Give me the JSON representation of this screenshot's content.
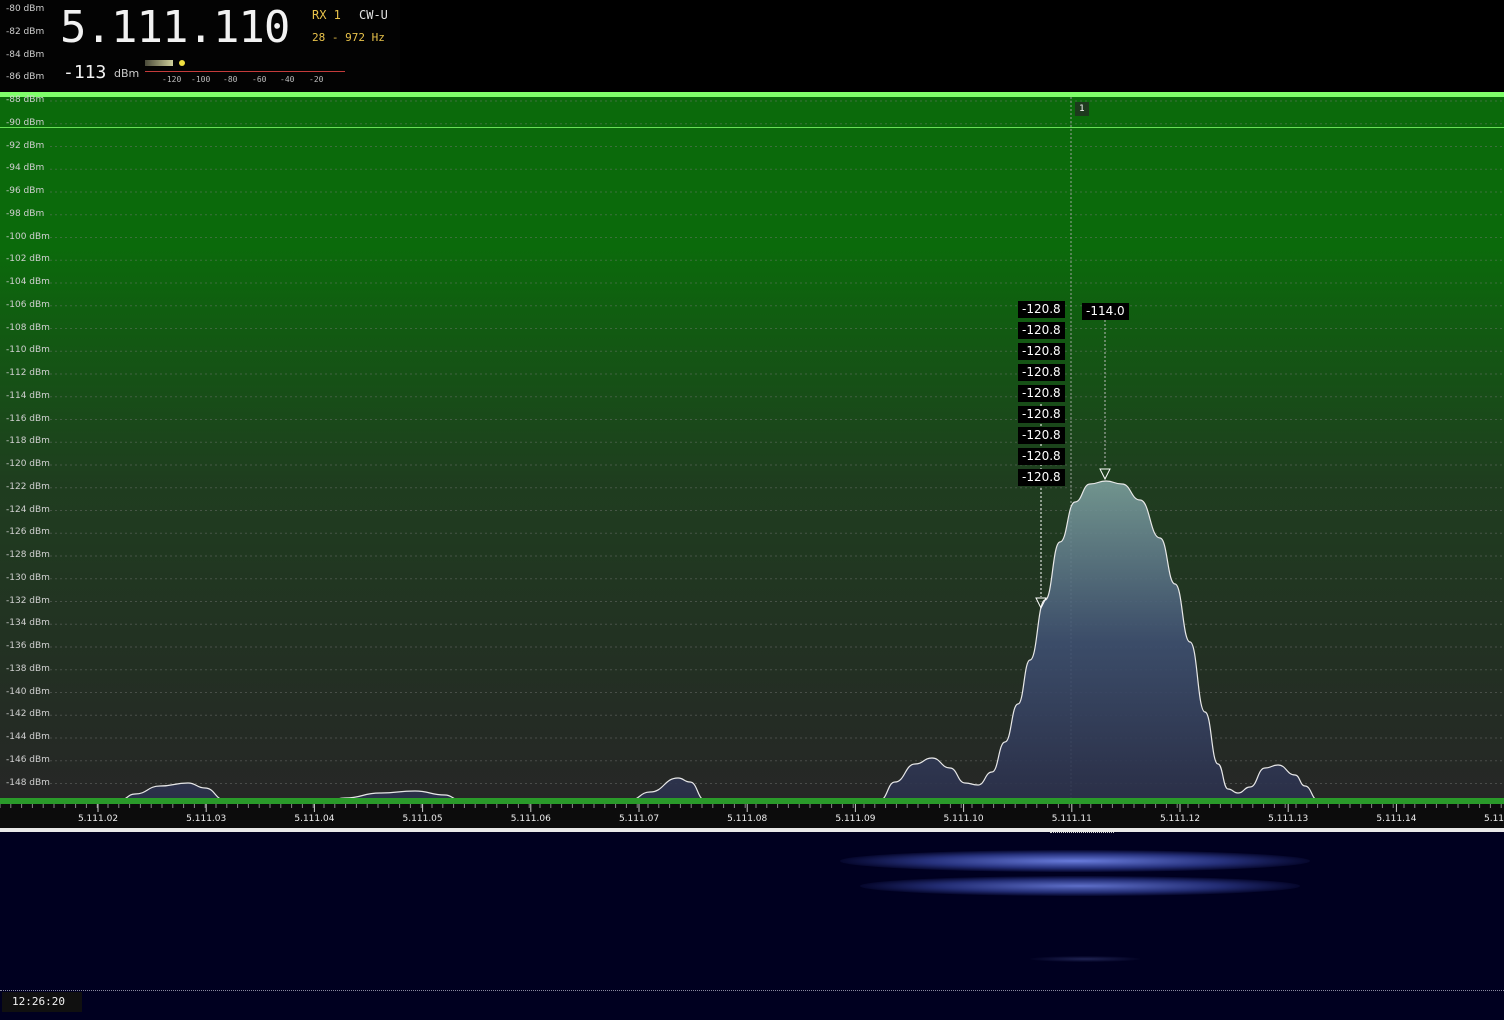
{
  "header": {
    "frequency": "5.111.110",
    "rx_label": "RX 1",
    "mode": "CW-U",
    "bandwidth": "28 - 972 Hz",
    "signal_value": "-113",
    "signal_unit": "dBm",
    "meter_ticks": [
      "-120",
      "-100",
      "-80",
      "-60",
      "-40",
      "-20"
    ]
  },
  "spectrum": {
    "dbm_labels": [
      "-80 dBm",
      "-82 dBm",
      "-84 dBm",
      "-86 dBm",
      "-88 dBm",
      "-90 dBm",
      "-92 dBm",
      "-94 dBm",
      "-96 dBm",
      "-98 dBm",
      "-100 dBm",
      "-102 dBm",
      "-104 dBm",
      "-106 dBm",
      "-108 dBm",
      "-110 dBm",
      "-112 dBm",
      "-114 dBm",
      "-116 dBm",
      "-118 dBm",
      "-120 dBm",
      "-122 dBm",
      "-124 dBm",
      "-126 dBm",
      "-128 dBm",
      "-130 dBm",
      "-132 dBm",
      "-134 dBm",
      "-136 dBm",
      "-138 dBm",
      "-140 dBm",
      "-142 dBm",
      "-144 dBm",
      "-146 dBm",
      "-148 dBm"
    ],
    "marker_label": "1",
    "peak_hold_values": [
      "-120.8",
      "-120.8",
      "-120.8",
      "-120.8",
      "-120.8",
      "-120.8",
      "-120.8",
      "-120.8",
      "-120.8"
    ],
    "peak_value": "-114.0",
    "colors": {
      "noise_band": "#0b6a0b",
      "bright_line": "#7fff6a",
      "trace": "#e8e8e8",
      "background": "#272727"
    }
  },
  "freq_scale": {
    "labels": [
      "5.111.02",
      "5.111.03",
      "5.111.04",
      "5.111.05",
      "5.111.06",
      "5.111.07",
      "5.111.08",
      "5.111.09",
      "5.111.10",
      "5.111.11",
      "5.111.12",
      "5.111.13",
      "5.111.14",
      "5.11"
    ]
  },
  "waterfall": {
    "time": "12:26:20",
    "colors": {
      "background": "#000020",
      "signal": "#4a5fd0"
    }
  }
}
